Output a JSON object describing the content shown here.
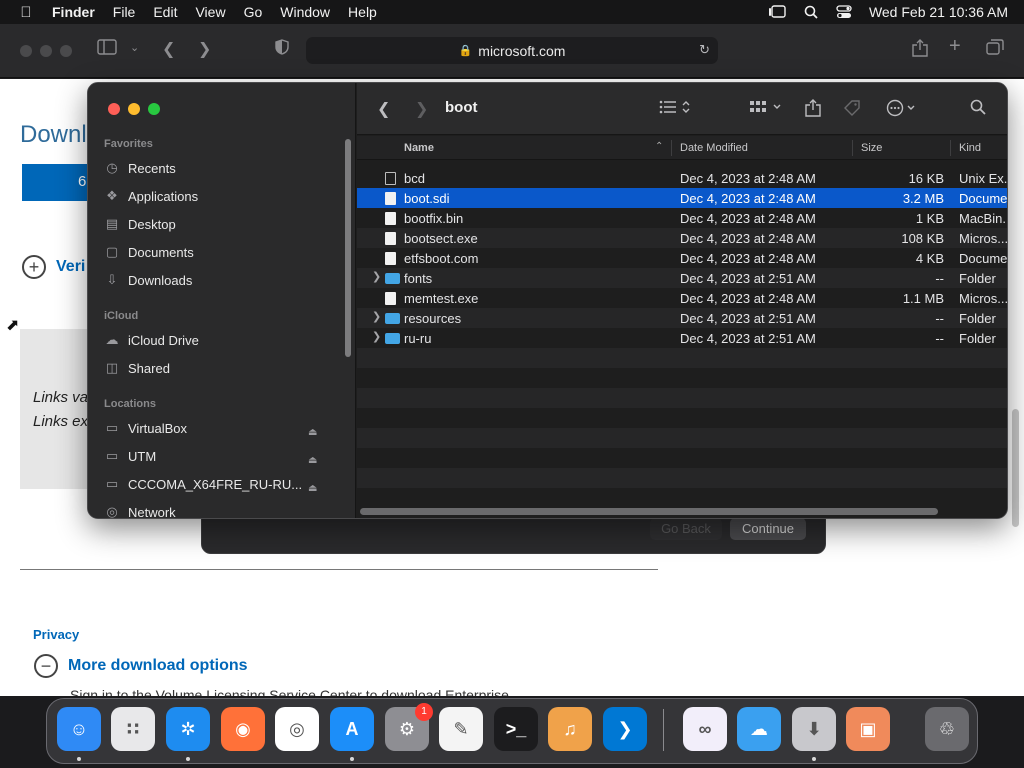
{
  "menubar": {
    "apple_icon": "apple-logo-icon",
    "app_name": "Finder",
    "menus": [
      "File",
      "Edit",
      "View",
      "Go",
      "Window",
      "Help"
    ],
    "clock": "Wed Feb 21  10:36 AM"
  },
  "safari": {
    "url": "microsoft.com"
  },
  "webpage": {
    "title": "Downl",
    "blue_button": "6",
    "verify_link": "Veri",
    "links_line1": "Links va",
    "links_line2": "Links ex",
    "privacy": "Privacy",
    "more_options": "More download options",
    "cut_text": "Sign in to the Volume Licensing Service Center to download Enterprise"
  },
  "installer": {
    "go_back": "Go Back",
    "continue": "Continue"
  },
  "finder": {
    "title": "boot",
    "sidebar": {
      "favorites_header": "Favorites",
      "favorites": [
        {
          "label": "Recents",
          "icon": "clock-icon"
        },
        {
          "label": "Applications",
          "icon": "applications-icon"
        },
        {
          "label": "Desktop",
          "icon": "desktop-icon"
        },
        {
          "label": "Documents",
          "icon": "document-icon"
        },
        {
          "label": "Downloads",
          "icon": "download-icon"
        }
      ],
      "icloud_header": "iCloud",
      "icloud": [
        {
          "label": "iCloud Drive",
          "icon": "cloud-icon"
        },
        {
          "label": "Shared",
          "icon": "shared-folder-icon"
        }
      ],
      "locations_header": "Locations",
      "locations": [
        {
          "label": "VirtualBox",
          "icon": "drive-icon"
        },
        {
          "label": "UTM",
          "icon": "drive-icon"
        },
        {
          "label": "CCCOMA_X64FRE_RU-RU...",
          "icon": "drive-icon"
        },
        {
          "label": "Network",
          "icon": "network-icon"
        }
      ]
    },
    "columns": {
      "name": "Name",
      "date": "Date Modified",
      "size": "Size",
      "kind": "Kind"
    },
    "files": [
      {
        "name": "bcd",
        "date": "Dec 4, 2023 at 2:48 AM",
        "size": "16 KB",
        "kind": "Unix Ex...",
        "type": "exec",
        "selected": false
      },
      {
        "name": "boot.sdi",
        "date": "Dec 4, 2023 at 2:48 AM",
        "size": "3.2 MB",
        "kind": "Docume",
        "type": "file",
        "selected": true
      },
      {
        "name": "bootfix.bin",
        "date": "Dec 4, 2023 at 2:48 AM",
        "size": "1 KB",
        "kind": "MacBin...",
        "type": "file",
        "selected": false
      },
      {
        "name": "bootsect.exe",
        "date": "Dec 4, 2023 at 2:48 AM",
        "size": "108 KB",
        "kind": "Micros...",
        "type": "file",
        "selected": false
      },
      {
        "name": "etfsboot.com",
        "date": "Dec 4, 2023 at 2:48 AM",
        "size": "4 KB",
        "kind": "Docume",
        "type": "file",
        "selected": false
      },
      {
        "name": "fonts",
        "date": "Dec 4, 2023 at 2:51 AM",
        "size": "--",
        "kind": "Folder",
        "type": "folder",
        "selected": false
      },
      {
        "name": "memtest.exe",
        "date": "Dec 4, 2023 at 2:48 AM",
        "size": "1.1 MB",
        "kind": "Micros...",
        "type": "file",
        "selected": false
      },
      {
        "name": "resources",
        "date": "Dec 4, 2023 at 2:51 AM",
        "size": "--",
        "kind": "Folder",
        "type": "folder",
        "selected": false
      },
      {
        "name": "ru-ru",
        "date": "Dec 4, 2023 at 2:51 AM",
        "size": "--",
        "kind": "Folder",
        "type": "folder",
        "selected": false
      }
    ]
  },
  "dock": {
    "apps": [
      {
        "name": "Finder",
        "color": "#2f8af5",
        "icon": "finder-icon",
        "running": true
      },
      {
        "name": "Launchpad",
        "color": "#e8e8ea",
        "icon": "launchpad-icon",
        "running": false
      },
      {
        "name": "Safari",
        "color": "#1e8cf0",
        "icon": "safari-icon",
        "running": true
      },
      {
        "name": "Firefox",
        "color": "#ff7139",
        "icon": "firefox-icon",
        "running": false
      },
      {
        "name": "Chrome",
        "color": "#ffffff",
        "icon": "chrome-icon",
        "running": false
      },
      {
        "name": "App Store",
        "color": "#1c8ef9",
        "icon": "app-store-icon",
        "running": true
      },
      {
        "name": "System Settings",
        "color": "#8e8e93",
        "icon": "gear-icon",
        "running": false,
        "badge": "1"
      },
      {
        "name": "TextEdit",
        "color": "#f4f4f4",
        "icon": "textedit-icon",
        "running": false
      },
      {
        "name": "Terminal",
        "color": "#1c1c1e",
        "icon": "terminal-icon",
        "running": false
      },
      {
        "name": "GarageBand",
        "color": "#f0a24a",
        "icon": "guitar-icon",
        "running": false
      },
      {
        "name": "Visual Studio Code",
        "color": "#0078d4",
        "icon": "vscode-icon",
        "running": false
      },
      {
        "name": "Visual Studio",
        "color": "#f2eefa",
        "icon": "visual-studio-icon",
        "running": false
      },
      {
        "name": "Weather",
        "color": "#3aa0f0",
        "icon": "weather-icon",
        "running": false
      },
      {
        "name": "Installer",
        "color": "#c8c8cc",
        "icon": "installer-icon",
        "running": true
      },
      {
        "name": "Boot Camp Assistant",
        "color": "#f08a5b",
        "icon": "bootcamp-icon",
        "running": false
      },
      {
        "name": "Trash",
        "color": "#6a6a6e",
        "icon": "trash-icon",
        "running": false
      }
    ]
  }
}
